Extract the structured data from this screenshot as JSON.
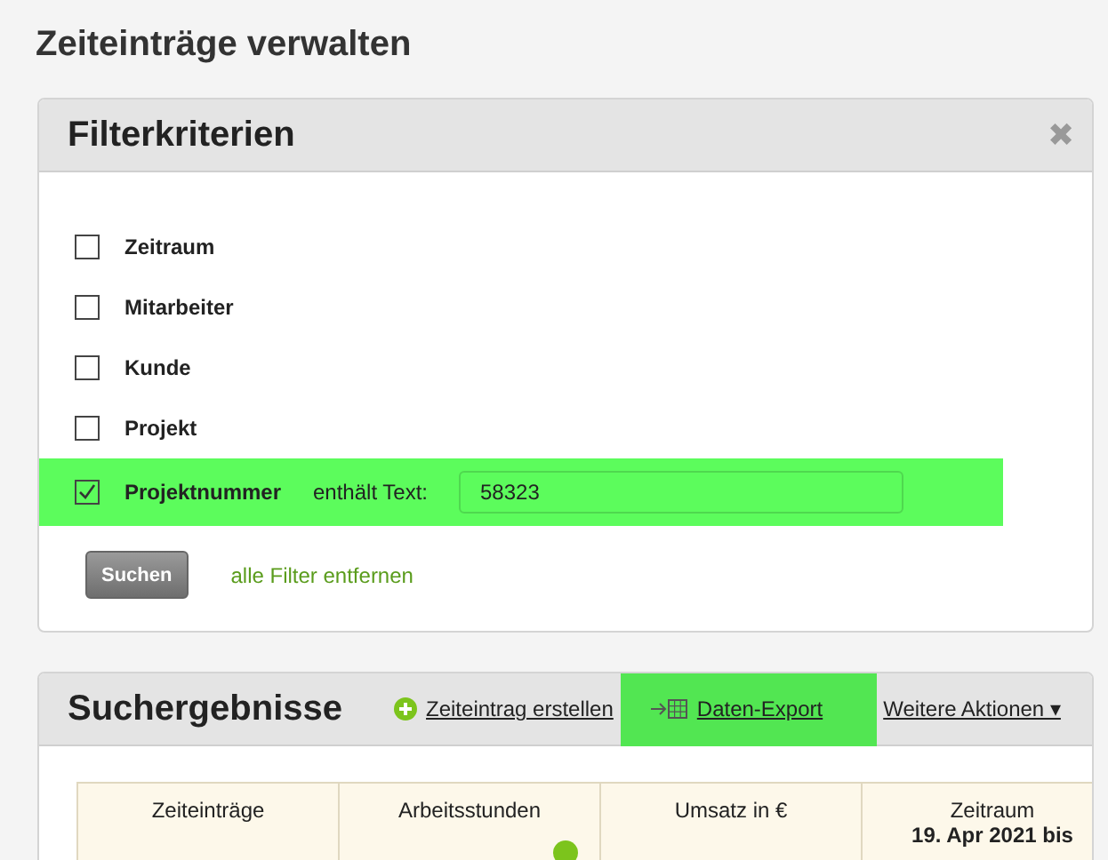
{
  "page_title": "Zeiteinträge verwalten",
  "filter_panel": {
    "title": "Filterkriterien",
    "close_icon": "✖",
    "filters": [
      {
        "label": "Zeitraum",
        "checked": false,
        "highlighted": false
      },
      {
        "label": "Mitarbeiter",
        "checked": false,
        "highlighted": false
      },
      {
        "label": "Kunde",
        "checked": false,
        "highlighted": false
      },
      {
        "label": "Projekt",
        "checked": false,
        "highlighted": false
      },
      {
        "label": "Projektnummer",
        "checked": true,
        "highlighted": true,
        "condition": "enthält Text:",
        "value": "58323"
      }
    ],
    "search_button": "Suchen",
    "clear_link": "alle Filter entfernen"
  },
  "results_panel": {
    "title": "Suchergebnisse",
    "actions": [
      {
        "kind": "add",
        "label": "Zeiteintrag erstellen",
        "highlighted": false
      },
      {
        "kind": "export",
        "label": "Daten-Export",
        "highlighted": true
      },
      {
        "kind": "menu",
        "label": "Weitere Aktionen ▾",
        "highlighted": false
      }
    ],
    "stats": [
      {
        "label": "Zeiteinträge"
      },
      {
        "label": "Arbeitsstunden",
        "status_dot": true
      },
      {
        "label": "Umsatz in €"
      },
      {
        "label": "Zeitraum",
        "value": "19. Apr 2021 bis"
      }
    ]
  }
}
